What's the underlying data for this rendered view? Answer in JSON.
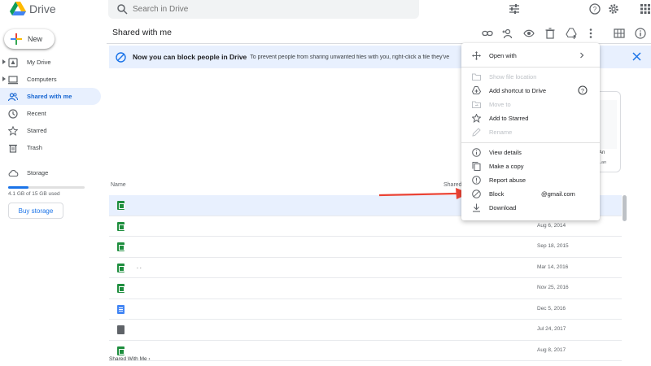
{
  "app": {
    "name": "Drive"
  },
  "search": {
    "placeholder": "Search in Drive"
  },
  "sidebar": {
    "new_label": "New",
    "items": [
      {
        "label": "My Drive"
      },
      {
        "label": "Computers"
      },
      {
        "label": "Shared with me"
      },
      {
        "label": "Recent"
      },
      {
        "label": "Starred"
      },
      {
        "label": "Trash"
      }
    ],
    "storage_label": "Storage",
    "storage_used_text": "4.1 GB of 15 GB used",
    "storage_fraction": 0.27,
    "buy_label": "Buy storage"
  },
  "main": {
    "title": "Shared with me",
    "banner": {
      "bold": "Now you can block people in Drive",
      "text": "To prevent people from sharing unwanted files with you, right-click a file they've"
    },
    "card": {
      "line1": "An",
      "line2": "Lan"
    },
    "columns": {
      "name": "Name",
      "shared": "Shared"
    },
    "rows": [
      {
        "type": "sheet",
        "name": "",
        "date": ""
      },
      {
        "type": "sheet",
        "name": "",
        "date": "Aug 6, 2014"
      },
      {
        "type": "sheet",
        "name": "",
        "date": "Sep 18, 2015"
      },
      {
        "type": "sheet",
        "name": ". .",
        "date": "Mar 14, 2016"
      },
      {
        "type": "sheet",
        "name": "",
        "date": "Nov 25, 2016"
      },
      {
        "type": "doc",
        "name": "",
        "date": "Dec 5, 2016"
      },
      {
        "type": "folder",
        "name": "",
        "date": "Jul 24, 2017"
      },
      {
        "type": "sheet",
        "name": "",
        "date": "Aug 8, 2017"
      }
    ],
    "breadcrumb": "Shared With Me"
  },
  "menu": {
    "open_with": "Open with",
    "show_location": "Show file location",
    "add_shortcut": "Add shortcut to Drive",
    "move_to": "Move to",
    "add_starred": "Add to Starred",
    "rename": "Rename",
    "view_details": "View details",
    "make_copy": "Make a copy",
    "report_abuse": "Report abuse",
    "block": "Block",
    "block_email": "@gmail.com",
    "download": "Download"
  },
  "colors": {
    "accent": "#1a73e8",
    "banner_bg": "#e8f0fe",
    "arrow": "#ea4335"
  }
}
